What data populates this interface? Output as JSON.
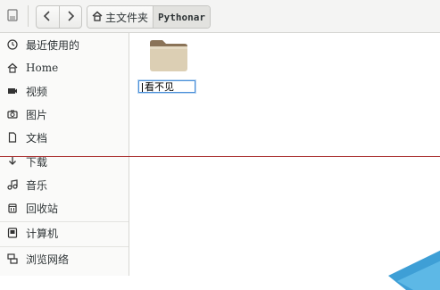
{
  "toolbar": {
    "app_icon": "drive-icon",
    "back_icon": "chevron-left-icon",
    "forward_icon": "chevron-right-icon"
  },
  "breadcrumb": [
    {
      "label": "主文件夹",
      "icon": "home-icon"
    },
    {
      "label": "Pythonar"
    }
  ],
  "sidebar": {
    "items": [
      {
        "label": "最近使用的",
        "icon": "clock-icon"
      },
      {
        "label": "Home",
        "icon": "home-icon"
      },
      {
        "label": "视频",
        "icon": "video-icon"
      },
      {
        "label": "图片",
        "icon": "camera-icon"
      },
      {
        "label": "文档",
        "icon": "document-icon"
      },
      {
        "label": "下载",
        "icon": "download-icon"
      },
      {
        "label": "音乐",
        "icon": "music-icon"
      },
      {
        "label": "回收站",
        "icon": "trash-icon"
      },
      {
        "label": "计算机",
        "icon": "computer-icon"
      },
      {
        "label": "浏览网络",
        "icon": "network-icon"
      }
    ]
  },
  "content": {
    "items": [
      {
        "name_value": "看不见",
        "icon": "folder-icon",
        "state": "renaming"
      }
    ]
  },
  "colors": {
    "accent": "#4a90d9",
    "folder": "#dccfb4",
    "annotation_line": "#a32020"
  }
}
